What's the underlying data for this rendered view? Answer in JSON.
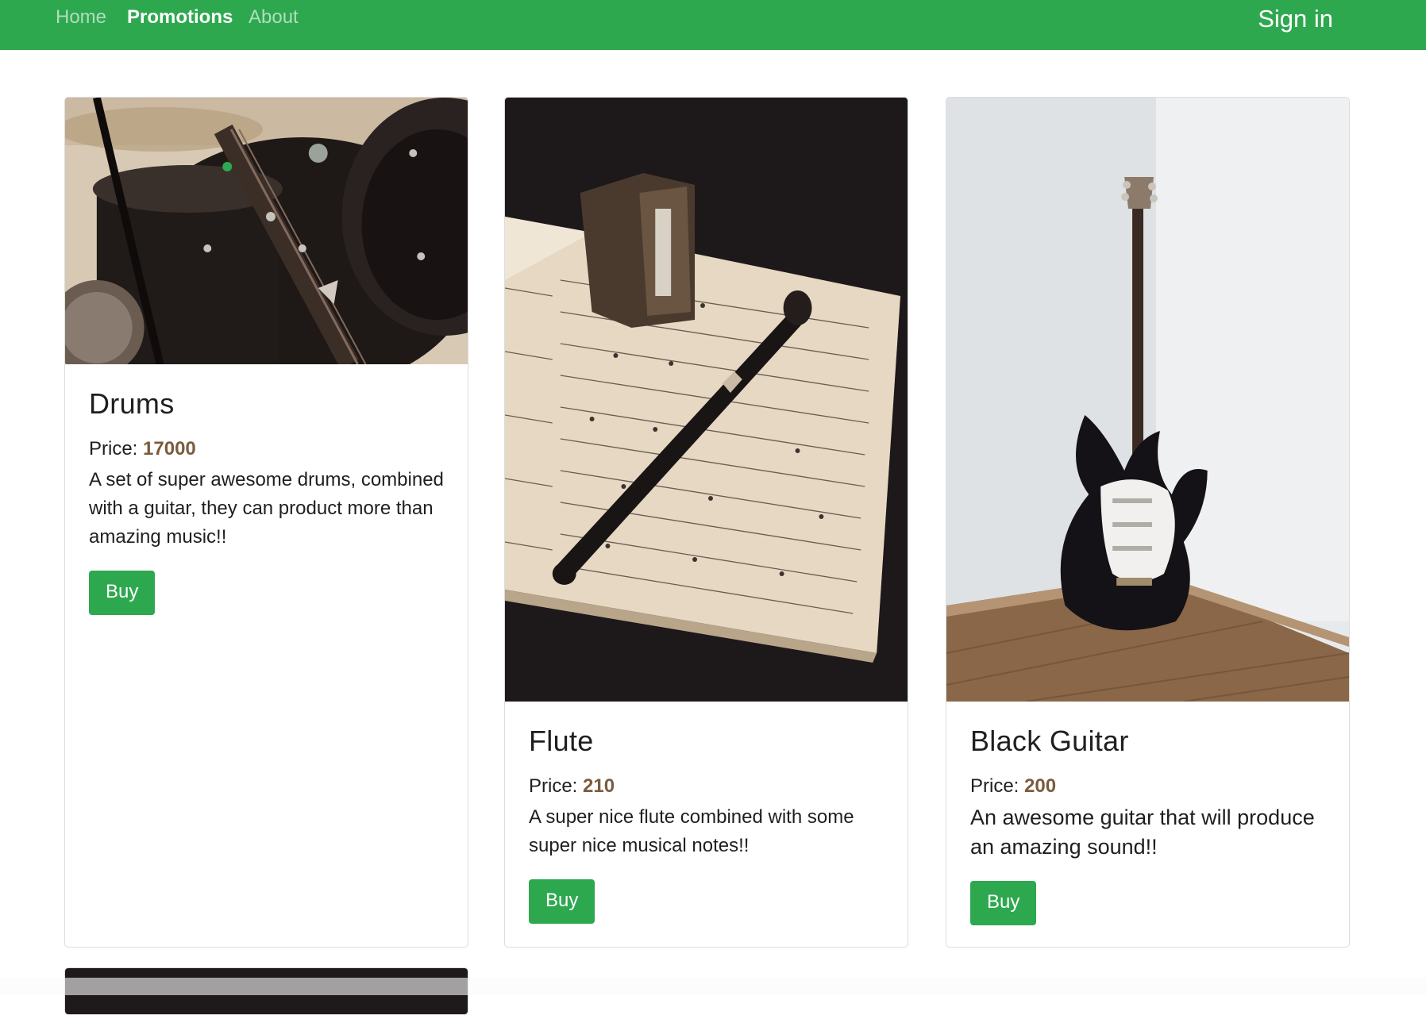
{
  "nav": {
    "home": "Home",
    "promotions": "Promotions",
    "about": "About",
    "sign_in": "Sign in",
    "active_item": "promotions"
  },
  "colors": {
    "brand_green": "#2ea84f",
    "price_brown": "#7a5c3e"
  },
  "cards": [
    {
      "title": "Drums",
      "price_label": "Price:",
      "price": "17000",
      "description": "A set of super awesome drums, combined with a guitar, they can product more than amazing music!!",
      "button": "Buy",
      "image": "drum-kit-with-guitar-photo"
    },
    {
      "title": "Flute",
      "price_label": "Price:",
      "price": "210",
      "description": "A super nice flute combined with some super nice musical notes!!",
      "button": "Buy",
      "image": "recorder-on-sheet-music-photo"
    },
    {
      "title": "Black Guitar",
      "price_label": "Price:",
      "price": "200",
      "description": "An awesome guitar that will produce an amazing sound!!",
      "button": "Buy",
      "image": "electric-guitar-in-corner-photo"
    },
    {
      "image": "dark-product-photo"
    }
  ]
}
